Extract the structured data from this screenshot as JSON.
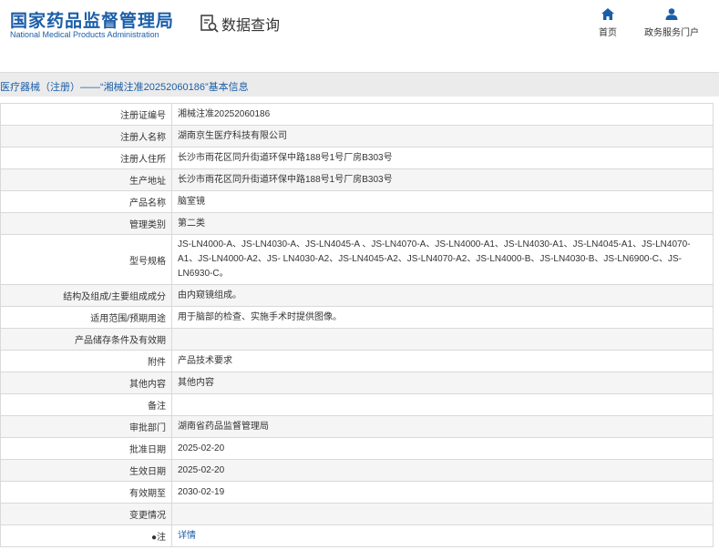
{
  "header": {
    "logo_cn": "国家药品监督管理局",
    "logo_en": "National Medical Products Administration",
    "query_label": "数据查询",
    "nav": {
      "home": "首页",
      "portal": "政务服务门户"
    }
  },
  "breadcrumb": "医疗器械（注册）——“湘械注准20252060186”基本信息",
  "colors": {
    "brand": "#1b5ea8",
    "crumb_bg": "#ebebeb",
    "border": "#d9d9d9"
  },
  "rows": [
    {
      "label": "注册证编号",
      "value": "湘械注准20252060186"
    },
    {
      "label": "注册人名称",
      "value": "湖南京生医疗科技有限公司"
    },
    {
      "label": "注册人住所",
      "value": "长沙市雨花区同升街道环保中路188号1号厂房B303号"
    },
    {
      "label": "生产地址",
      "value": "长沙市雨花区同升街道环保中路188号1号厂房B303号"
    },
    {
      "label": "产品名称",
      "value": "脑室镜"
    },
    {
      "label": "管理类别",
      "value": "第二类"
    },
    {
      "label": "型号规格",
      "value": "JS-LN4000-A、JS-LN4030-A、JS-LN4045-A 、JS-LN4070-A、JS-LN4000-A1、JS-LN4030-A1、JS-LN4045-A1、JS-LN4070-A1、JS-LN4000-A2、JS- LN4030-A2、JS-LN4045-A2、JS-LN4070-A2、JS-LN4000-B、JS-LN4030-B、JS-LN6900-C、JS-LN6930-C。"
    },
    {
      "label": "结构及组成/主要组成成分",
      "value": "由内窥镜组成。"
    },
    {
      "label": "适用范围/预期用途",
      "value": "用于脑部的检查、实施手术时提供图像。"
    },
    {
      "label": "产品储存条件及有效期",
      "value": ""
    },
    {
      "label": "附件",
      "value": "产品技术要求"
    },
    {
      "label": "其他内容",
      "value": "其他内容"
    },
    {
      "label": "备注",
      "value": ""
    },
    {
      "label": "审批部门",
      "value": "湖南省药品监督管理局"
    },
    {
      "label": "批准日期",
      "value": "2025-02-20"
    },
    {
      "label": "生效日期",
      "value": "2025-02-20"
    },
    {
      "label": "有效期至",
      "value": "2030-02-19"
    },
    {
      "label": "变更情况",
      "value": ""
    },
    {
      "label": "●注",
      "value": "详情"
    }
  ]
}
